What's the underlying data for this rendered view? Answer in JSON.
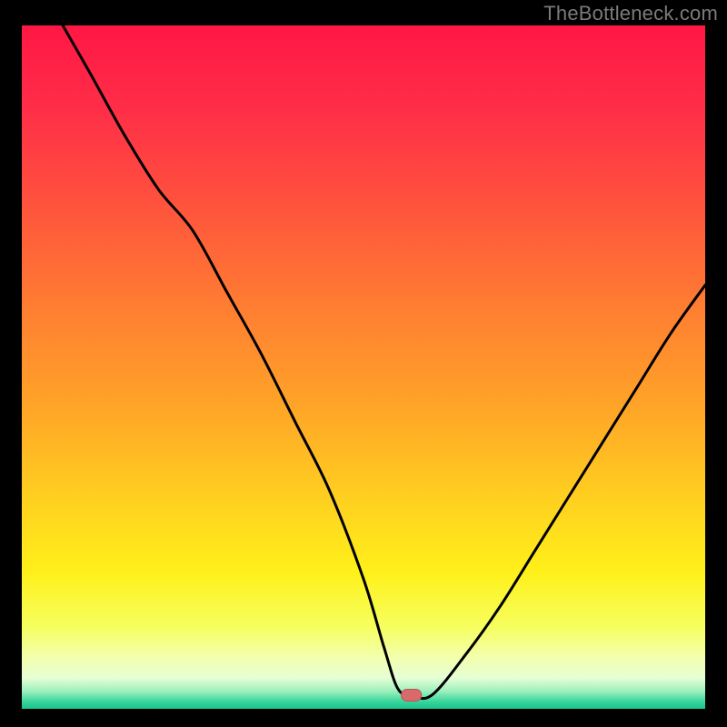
{
  "watermark": "TheBottleneck.com",
  "colors": {
    "bg": "#000000",
    "curve": "#000000",
    "marker_fill": "#d86a6a",
    "marker_stroke": "#b85454",
    "gradient_stops": [
      {
        "offset": 0.0,
        "color": "#ff1744"
      },
      {
        "offset": 0.12,
        "color": "#ff2d48"
      },
      {
        "offset": 0.25,
        "color": "#ff4f3e"
      },
      {
        "offset": 0.4,
        "color": "#ff7a33"
      },
      {
        "offset": 0.55,
        "color": "#ffa228"
      },
      {
        "offset": 0.7,
        "color": "#ffd21f"
      },
      {
        "offset": 0.8,
        "color": "#fff01a"
      },
      {
        "offset": 0.88,
        "color": "#f6ff5e"
      },
      {
        "offset": 0.92,
        "color": "#f4ffa6"
      },
      {
        "offset": 0.955,
        "color": "#e6ffd6"
      },
      {
        "offset": 0.975,
        "color": "#9aeebc"
      },
      {
        "offset": 0.99,
        "color": "#35d59a"
      },
      {
        "offset": 1.0,
        "color": "#18c28d"
      }
    ]
  },
  "chart_data": {
    "type": "line",
    "title": "",
    "xlabel": "",
    "ylabel": "",
    "xlim": [
      0,
      100
    ],
    "ylim": [
      0,
      100
    ],
    "legend": false,
    "grid": false,
    "marker": {
      "x": 57,
      "y": 2,
      "shape": "rounded-rect"
    },
    "series": [
      {
        "name": "bottleneck-curve",
        "x": [
          6,
          10,
          15,
          20,
          25,
          30,
          35,
          40,
          45,
          50,
          53,
          55,
          57,
          60,
          65,
          70,
          75,
          80,
          85,
          90,
          95,
          100
        ],
        "y": [
          100,
          93,
          84,
          76,
          70,
          61,
          52,
          42,
          32,
          19,
          9,
          3,
          2,
          2,
          8,
          15,
          23,
          31,
          39,
          47,
          55,
          62
        ]
      }
    ]
  }
}
